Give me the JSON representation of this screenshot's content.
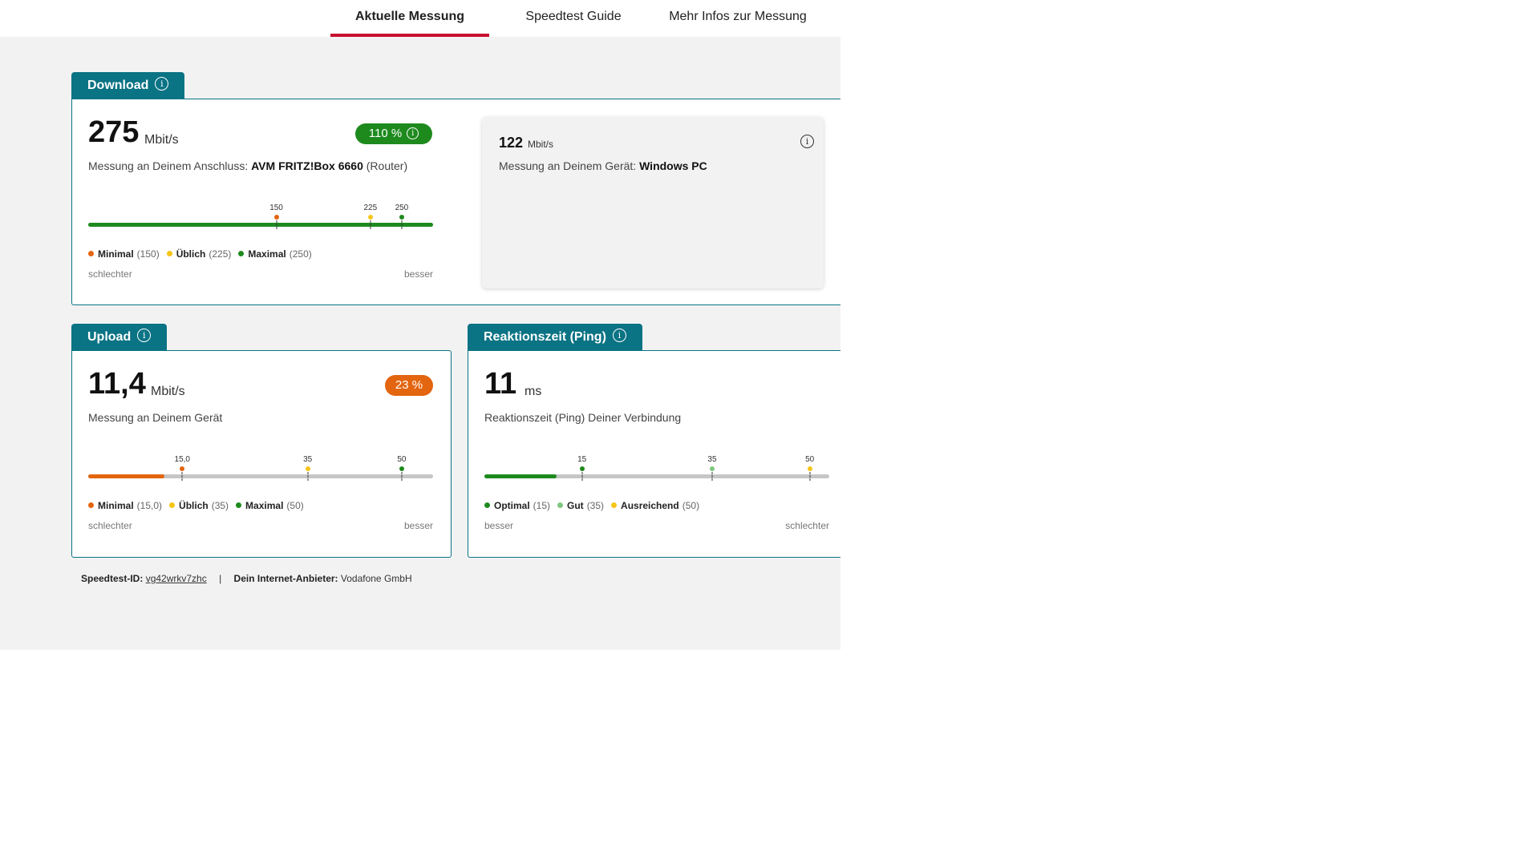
{
  "colors": {
    "accent_red": "#c8102e",
    "teal": "#0a7384",
    "green": "#1e8a1e",
    "orange": "#e3650f",
    "yellow": "#f5c518",
    "light_green": "#7fc77f",
    "track_gray": "#c6c6c6"
  },
  "nav": {
    "tabs": [
      {
        "label": "Aktuelle Messung",
        "active": true
      },
      {
        "label": "Speedtest Guide",
        "active": false
      },
      {
        "label": "Mehr Infos zur Messung",
        "active": false
      }
    ]
  },
  "download": {
    "title": "Download",
    "info_icon": "info-icon",
    "value": "275",
    "unit": "Mbit/s",
    "percent": "110 %",
    "desc_prefix": "Messung an Deinem Anschluss: ",
    "desc_device": "AVM FRITZ!Box 6660",
    "desc_suffix": " (Router)",
    "bar": {
      "min": 0,
      "max": 275,
      "fill": 1.0,
      "fill_color": "#1e8a1e"
    },
    "markers": [
      {
        "label": "150",
        "value": 150,
        "color": "#e3650f"
      },
      {
        "label": "225",
        "value": 225,
        "color": "#f5c518"
      },
      {
        "label": "250",
        "value": 250,
        "color": "#1e8a1e"
      }
    ],
    "legend": [
      {
        "name": "Minimal",
        "value": "(150)",
        "color": "#e3650f"
      },
      {
        "name": "Üblich",
        "value": "(225)",
        "color": "#f5c518"
      },
      {
        "name": "Maximal",
        "value": "(250)",
        "color": "#1e8a1e"
      }
    ],
    "scale_left": "schlechter",
    "scale_right": "besser",
    "device": {
      "value": "122",
      "unit": "Mbit/s",
      "desc_prefix": "Messung an Deinem Gerät: ",
      "desc_device": "Windows PC"
    }
  },
  "upload": {
    "title": "Upload",
    "info_icon": "info-icon",
    "value": "11,4",
    "unit": "Mbit/s",
    "percent": "23 %",
    "desc": "Messung an Deinem Gerät",
    "bar": {
      "min": 0,
      "max": 55,
      "fill": 0.22,
      "fill_color": "#e3650f"
    },
    "markers": [
      {
        "label": "15,0",
        "value": 15,
        "color": "#e3650f"
      },
      {
        "label": "35",
        "value": 35,
        "color": "#f5c518"
      },
      {
        "label": "50",
        "value": 50,
        "color": "#1e8a1e"
      }
    ],
    "legend": [
      {
        "name": "Minimal",
        "value": "(15,0)",
        "color": "#e3650f"
      },
      {
        "name": "Üblich",
        "value": "(35)",
        "color": "#f5c518"
      },
      {
        "name": "Maximal",
        "value": "(50)",
        "color": "#1e8a1e"
      }
    ],
    "scale_left": "schlechter",
    "scale_right": "besser"
  },
  "ping": {
    "title": "Reaktionszeit (Ping)",
    "info_icon": "info-icon",
    "value": "11",
    "unit": "ms",
    "desc": "Reaktionszeit (Ping) Deiner Verbindung",
    "bar": {
      "min": 0,
      "max": 53,
      "fill": 0.21,
      "fill_color": "#1e8a1e"
    },
    "markers": [
      {
        "label": "15",
        "value": 15,
        "color": "#1e8a1e"
      },
      {
        "label": "35",
        "value": 35,
        "color": "#7fc77f"
      },
      {
        "label": "50",
        "value": 50,
        "color": "#f5c518"
      }
    ],
    "legend": [
      {
        "name": "Optimal",
        "value": "(15)",
        "color": "#1e8a1e"
      },
      {
        "name": "Gut",
        "value": "(35)",
        "color": "#7fc77f"
      },
      {
        "name": "Ausreichend",
        "value": "(50)",
        "color": "#f5c518"
      }
    ],
    "scale_left": "besser",
    "scale_right": "schlechter"
  },
  "footer": {
    "id_label": "Speedtest-ID:",
    "id_value": "vg42wrkv7zhc",
    "separator": "|",
    "provider_label": "Dein Internet-Anbieter:",
    "provider_value": "Vodafone GmbH"
  }
}
